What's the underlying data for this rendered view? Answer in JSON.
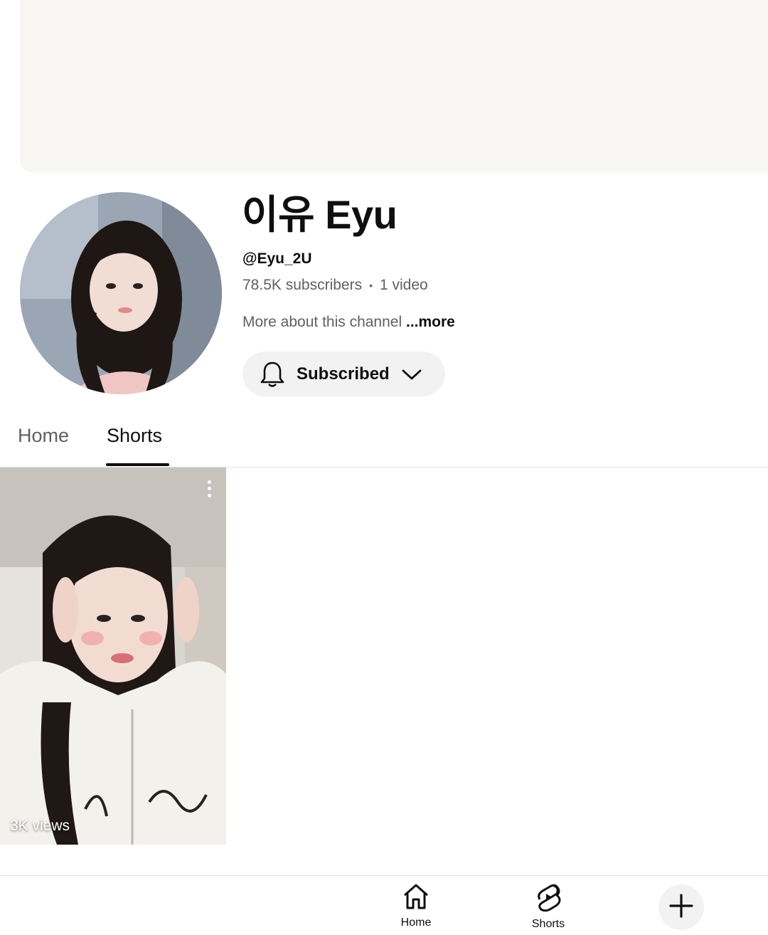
{
  "channel": {
    "name": "이유 Eyu",
    "handle": "@Eyu_2U",
    "subscribers": "78.5K subscribers",
    "separator": "•",
    "videos": "1 video",
    "about_text": "More about this channel",
    "about_more": "...more",
    "subscribe_label": "Subscribed"
  },
  "tabs": [
    {
      "label": "Home",
      "active": false
    },
    {
      "label": "Shorts",
      "active": true
    }
  ],
  "shorts": [
    {
      "views": "3K views"
    }
  ],
  "bottom_nav": {
    "home_label": "Home",
    "shorts_label": "Shorts"
  },
  "icons": {
    "bell": "bell-icon",
    "chevron": "chevron-down-icon",
    "more": "more-vert-icon",
    "home": "home-icon",
    "shorts": "shorts-icon",
    "create": "plus-icon"
  },
  "colors": {
    "text_primary": "#0f0f0f",
    "text_secondary": "#606060",
    "button_bg": "#f2f2f2",
    "banner_bg": "#f8f7f4"
  }
}
